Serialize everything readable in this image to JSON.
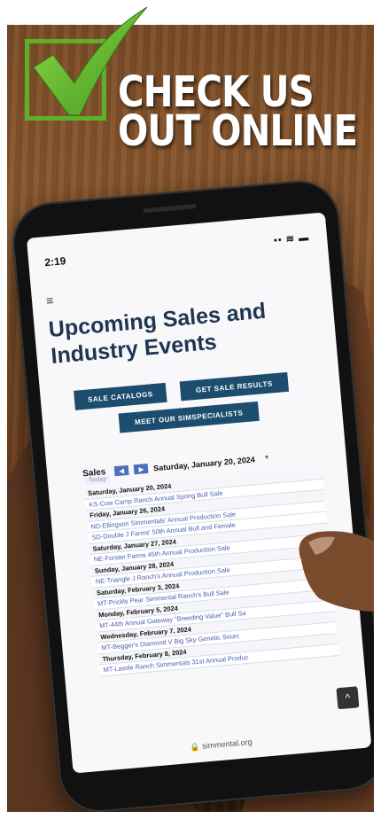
{
  "headline": {
    "line1": "CHECK US",
    "line2": "OUT ONLINE"
  },
  "colors": {
    "check_green": "#5db02a",
    "button_blue": "#1d4d6e",
    "link_blue": "#4c5fb0",
    "heading_navy": "#1f3550"
  },
  "phone": {
    "time": "2:19",
    "status_icons": "▪▪ ≋ ▬",
    "menu_icon": "≡",
    "page_title": "Upcoming Sales and Industry Events",
    "buttons": {
      "sale_catalogs": "SALE CATALOGS",
      "get_sale_results": "GET SALE RESULTS",
      "meet_simspecialists": "MEET OUR SIMSPECIALISTS"
    },
    "calendar": {
      "label": "Sales",
      "today": "Today",
      "prev": "◀",
      "next": "▶",
      "current_date": "Saturday, January 20, 2024",
      "rows": [
        {
          "type": "date",
          "text": "Saturday, January 20, 2024"
        },
        {
          "type": "event",
          "text": "KS-Cow Camp Ranch Annual Spring Bull Sale"
        },
        {
          "type": "date",
          "text": "Friday, January 26, 2024"
        },
        {
          "type": "event",
          "text": "ND-Ellingson Simmentals' Annual Production Sale"
        },
        {
          "type": "event",
          "text": "SD-Double J Farms' 50th Annual Bull and Female"
        },
        {
          "type": "date",
          "text": "Saturday, January 27, 2024"
        },
        {
          "type": "event",
          "text": "NE-Forster Farms 45th Annual Production Sale"
        },
        {
          "type": "date",
          "text": "Sunday, January 28, 2024"
        },
        {
          "type": "event",
          "text": "NE-Triangle J Ranch's Annual Production Sale"
        },
        {
          "type": "date",
          "text": "Saturday, February 3, 2024"
        },
        {
          "type": "event",
          "text": "MT-Prickly Pear Simmental Ranch's Bull Sale"
        },
        {
          "type": "date",
          "text": "Monday, February 5, 2024"
        },
        {
          "type": "event",
          "text": "MT-44th Annual Gateway \"Breeding Value\" Bull Sa"
        },
        {
          "type": "date",
          "text": "Wednesday, February 7, 2024"
        },
        {
          "type": "event",
          "text": "MT-Begger's Diamond V Big Sky Genetic Sourc"
        },
        {
          "type": "date",
          "text": "Thursday, February 8, 2024"
        },
        {
          "type": "event",
          "text": "MT-Lassle Ranch Simmentals 31st Annual Produc"
        }
      ]
    },
    "scroll_top": "^",
    "url": "🔒 simmental.org"
  }
}
